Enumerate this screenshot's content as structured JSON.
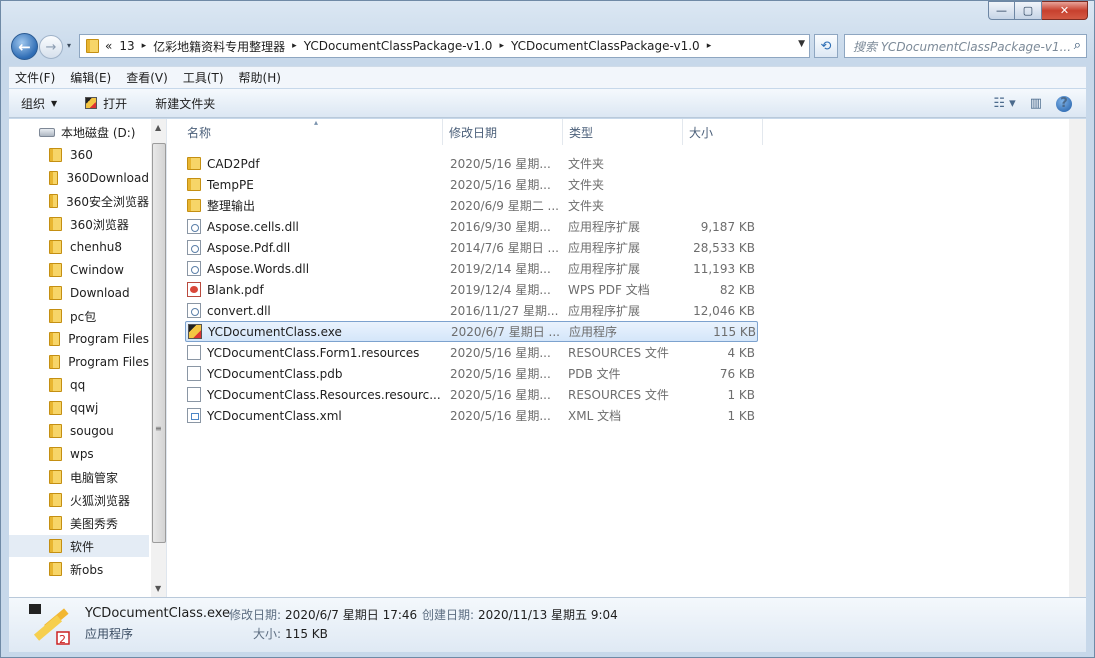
{
  "window": {
    "caption": {
      "min": "—",
      "max": "▢",
      "close": "✕"
    }
  },
  "nav": {
    "back_glyph": "←",
    "forward_glyph": "→",
    "recent_glyph": "▾",
    "refresh_glyph": "⟲",
    "address": {
      "overflow": "«",
      "segments": [
        "13",
        "亿彩地籍资料专用整理器",
        "YCDocumentClassPackage-v1.0",
        "YCDocumentClassPackage-v1.0"
      ],
      "separator": "▸",
      "dropdown": "▼"
    },
    "search_placeholder": "搜索 YCDocumentClassPackage-v1...",
    "search_icon": "⌕"
  },
  "menu": [
    "文件(F)",
    "编辑(E)",
    "查看(V)",
    "工具(T)",
    "帮助(H)"
  ],
  "toolbar": {
    "organize": "组织",
    "organize_arrow": "▼",
    "open": "打开",
    "new_folder": "新建文件夹",
    "views_glyph": "☷ ▾",
    "preview_glyph": "▥",
    "help": "?"
  },
  "navpane": {
    "drive": "本地磁盘 (D:)",
    "folders": [
      "360",
      "360Download",
      "360安全浏览器",
      "360浏览器",
      "chenhu8",
      "Cwindow",
      "Download",
      "pc包",
      "Program Files",
      "Program Files",
      "qq",
      "qqwj",
      "sougou",
      "wps",
      "电脑管家",
      "火狐浏览器",
      "美图秀秀",
      "软件",
      "新obs"
    ],
    "selected_index": 17,
    "scroll_up": "▲",
    "scroll_down": "▼",
    "scroll_grip": "≡"
  },
  "columns": {
    "name": "名称",
    "date": "修改日期",
    "type": "类型",
    "size": "大小",
    "sort_indicator": "▴"
  },
  "files": [
    {
      "name": "CAD2Pdf",
      "date": "2020/5/16 星期...",
      "type": "文件夹",
      "size": "",
      "icon": "folder-icon"
    },
    {
      "name": "TempPE",
      "date": "2020/5/16 星期...",
      "type": "文件夹",
      "size": "",
      "icon": "folder-icon"
    },
    {
      "name": "整理输出",
      "date": "2020/6/9 星期二 ...",
      "type": "文件夹",
      "size": "",
      "icon": "folder-icon"
    },
    {
      "name": "Aspose.cells.dll",
      "date": "2016/9/30 星期...",
      "type": "应用程序扩展",
      "size": "9,187 KB",
      "icon": "dll-icon"
    },
    {
      "name": "Aspose.Pdf.dll",
      "date": "2014/7/6 星期日 ...",
      "type": "应用程序扩展",
      "size": "28,533 KB",
      "icon": "dll-icon"
    },
    {
      "name": "Aspose.Words.dll",
      "date": "2019/2/14 星期...",
      "type": "应用程序扩展",
      "size": "11,193 KB",
      "icon": "dll-icon"
    },
    {
      "name": "Blank.pdf",
      "date": "2019/12/4 星期...",
      "type": "WPS PDF 文档",
      "size": "82 KB",
      "icon": "pdf-icon"
    },
    {
      "name": "convert.dll",
      "date": "2016/11/27 星期...",
      "type": "应用程序扩展",
      "size": "12,046 KB",
      "icon": "dll-icon"
    },
    {
      "name": "YCDocumentClass.exe",
      "date": "2020/6/7 星期日 ...",
      "type": "应用程序",
      "size": "115 KB",
      "icon": "exe-icon"
    },
    {
      "name": "YCDocumentClass.Form1.resources",
      "date": "2020/5/16 星期...",
      "type": "RESOURCES 文件",
      "size": "4 KB",
      "icon": "document-icon"
    },
    {
      "name": "YCDocumentClass.pdb",
      "date": "2020/5/16 星期...",
      "type": "PDB 文件",
      "size": "76 KB",
      "icon": "document-icon"
    },
    {
      "name": "YCDocumentClass.Resources.resourc...",
      "date": "2020/5/16 星期...",
      "type": "RESOURCES 文件",
      "size": "1 KB",
      "icon": "document-icon"
    },
    {
      "name": "YCDocumentClass.xml",
      "date": "2020/5/16 星期...",
      "type": "XML 文档",
      "size": "1 KB",
      "icon": "xml-icon"
    }
  ],
  "selected_file_index": 8,
  "details": {
    "name": "YCDocumentClass.exe",
    "type": "应用程序",
    "modified_label": "修改日期:",
    "modified_value": "2020/6/7 星期日 17:46",
    "created_label": "创建日期:",
    "created_value": "2020/11/13 星期五 9:04",
    "size_label": "大小:",
    "size_value": "115 KB"
  }
}
